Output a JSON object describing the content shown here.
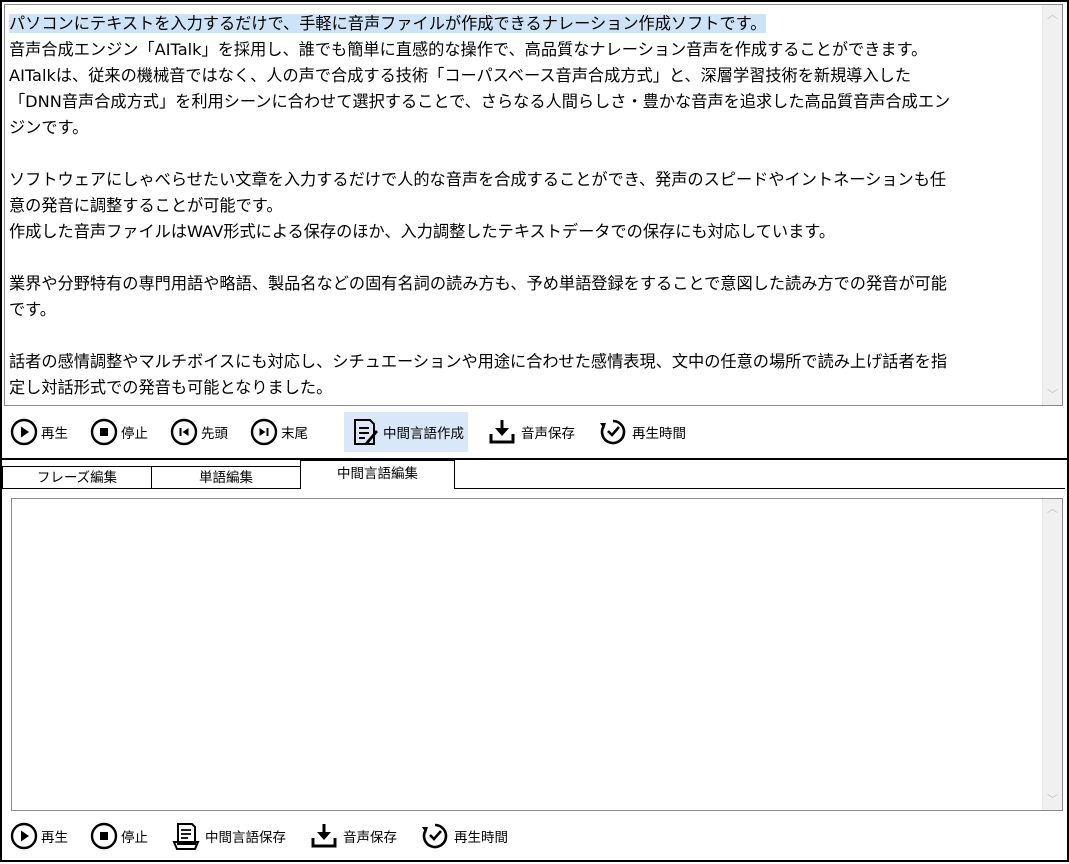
{
  "editor": {
    "selected_text": "パソコンにテキストを入力するだけで、手軽に音声ファイルが作成できるナレーション作成ソフトです。",
    "lines": [
      "音声合成エンジン「AITalk」を採用し、誰でも簡単に直感的な操作で、高品質なナレーション音声を作成することができます。",
      "AITalkは、従来の機械音ではなく、人の声で合成する技術「コーパスベース音声合成方式」と、深層学習技術を新規導入した",
      "「DNN音声合成方式」を利用シーンに合わせて選択することで、さらなる人間らしさ・豊かな音声を追求した高品質音声合成エン",
      "ジンです。",
      "",
      "ソフトウェアにしゃべらせたい文章を入力するだけで人的な音声を合成することができ、発声のスピードやイントネーションも任",
      "意の発音に調整することが可能です。",
      "作成した音声ファイルはWAV形式による保存のほか、入力調整したテキストデータでの保存にも対応しています。",
      "",
      "業界や分野特有の専門用語や略語、製品名などの固有名詞の読み方も、予め単語登録をすることで意図した読み方での発音が可能",
      "です。",
      "",
      "話者の感情調整やマルチボイスにも対応し、シチュエーションや用途に合わせた感情表現、文中の任意の場所で読み上げ話者を指",
      "定し対話形式での発音も可能となりました。"
    ]
  },
  "toolbar_top": {
    "play": "再生",
    "stop": "停止",
    "start": "先頭",
    "end": "末尾",
    "create_intermediate": "中間言語作成",
    "save_audio": "音声保存",
    "play_time": "再生時間"
  },
  "tabs": [
    "フレーズ編集",
    "単語編集",
    "中間言語編集"
  ],
  "toolbar_bottom": {
    "play": "再生",
    "stop": "停止",
    "save_intermediate": "中間言語保存",
    "save_audio": "音声保存",
    "play_time": "再生時間"
  },
  "colors": {
    "selection": "#cde3f7",
    "active_button": "#d9e8f8"
  }
}
